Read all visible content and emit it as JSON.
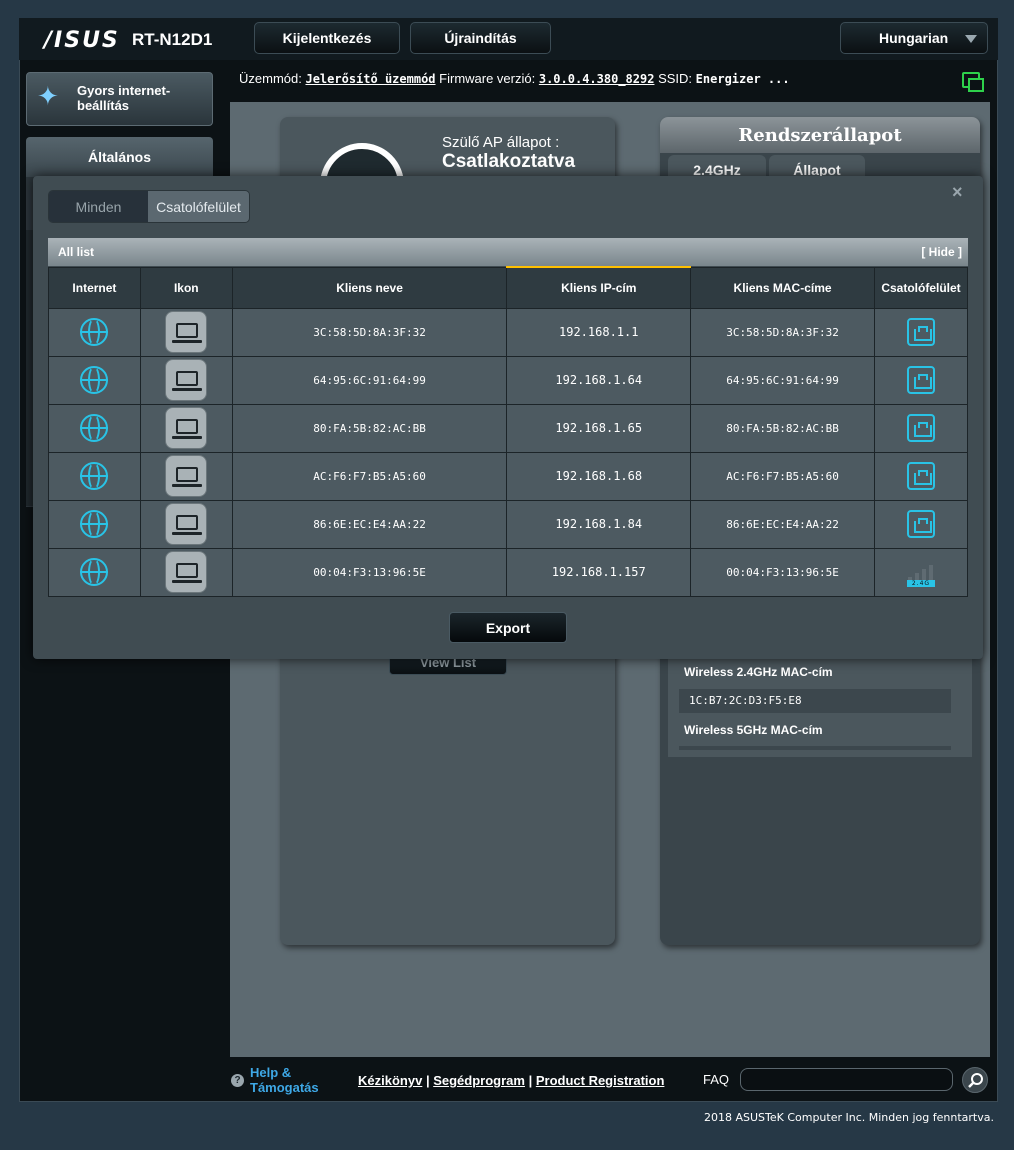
{
  "header": {
    "logo": "/ISUS",
    "model": "RT-N12D1",
    "logout_label": "Kijelentkezés",
    "reboot_label": "Újraindítás",
    "language": "Hungarian"
  },
  "sidebar": {
    "quick_setup": "Gyors internet-beállítás",
    "general": "Általános"
  },
  "statusbar": {
    "mode_label": "Üzemmód:",
    "mode_value": "Jelerősítő üzemmód",
    "firmware_label": "Firmware verzió:",
    "firmware_value": "3.0.0.4.380_8292",
    "ssid_label": "SSID:",
    "ssid_value": "Energizer ..."
  },
  "main": {
    "ap_status_label": "Szülő AP állapot :",
    "ap_status_value": "Csatlakoztatva",
    "view_list": "View List",
    "system_status_title": "Rendszerállapot",
    "tab_24": "2.4GHz",
    "tab_state": "Állapot",
    "wireless_24_mac_label": "Wireless 2.4GHz MAC-cím",
    "wireless_24_mac_value": "1C:B7:2C:D3:F5:E8",
    "wireless_5_mac_label": "Wireless 5GHz MAC-cím"
  },
  "modal": {
    "tab_all": "Minden",
    "tab_interface": "Csatolófelület",
    "close": "×",
    "list_title": "All list",
    "hide_label": "[ Hide ]",
    "columns": [
      "Internet",
      "Ikon",
      "Kliens neve",
      "Kliens IP-cím",
      "Kliens MAC-címe",
      "Csatolófelület"
    ],
    "rows": [
      {
        "name": "3C:58:5D:8A:3F:32",
        "ip": "192.168.1.1",
        "mac": "3C:58:5D:8A:3F:32",
        "iface": "ethernet"
      },
      {
        "name": "64:95:6C:91:64:99",
        "ip": "192.168.1.64",
        "mac": "64:95:6C:91:64:99",
        "iface": "ethernet"
      },
      {
        "name": "80:FA:5B:82:AC:BB",
        "ip": "192.168.1.65",
        "mac": "80:FA:5B:82:AC:BB",
        "iface": "ethernet"
      },
      {
        "name": "AC:F6:F7:B5:A5:60",
        "ip": "192.168.1.68",
        "mac": "AC:F6:F7:B5:A5:60",
        "iface": "ethernet"
      },
      {
        "name": "86:6E:EC:E4:AA:22",
        "ip": "192.168.1.84",
        "mac": "86:6E:EC:E4:AA:22",
        "iface": "ethernet"
      },
      {
        "name": "00:04:F3:13:96:5E",
        "ip": "192.168.1.157",
        "mac": "00:04:F3:13:96:5E",
        "iface": "wireless-2.4G"
      }
    ],
    "wifi_band_label": "2.4G",
    "export_label": "Export"
  },
  "footer": {
    "help_line1": "Help &",
    "help_line2": "Támogatás",
    "link_manual": "Kézikönyv",
    "link_utility": "Segédprogram",
    "link_registration": "Product Registration",
    "separator": "|",
    "faq_label": "FAQ",
    "copyright": "2018 ASUSTeK Computer Inc. Minden jog fenntartva."
  },
  "colors": {
    "accent": "#29c3e6",
    "sorted_column": "#ffc000",
    "link": "#3ea8e6",
    "network_ok": "#2ed14b"
  }
}
